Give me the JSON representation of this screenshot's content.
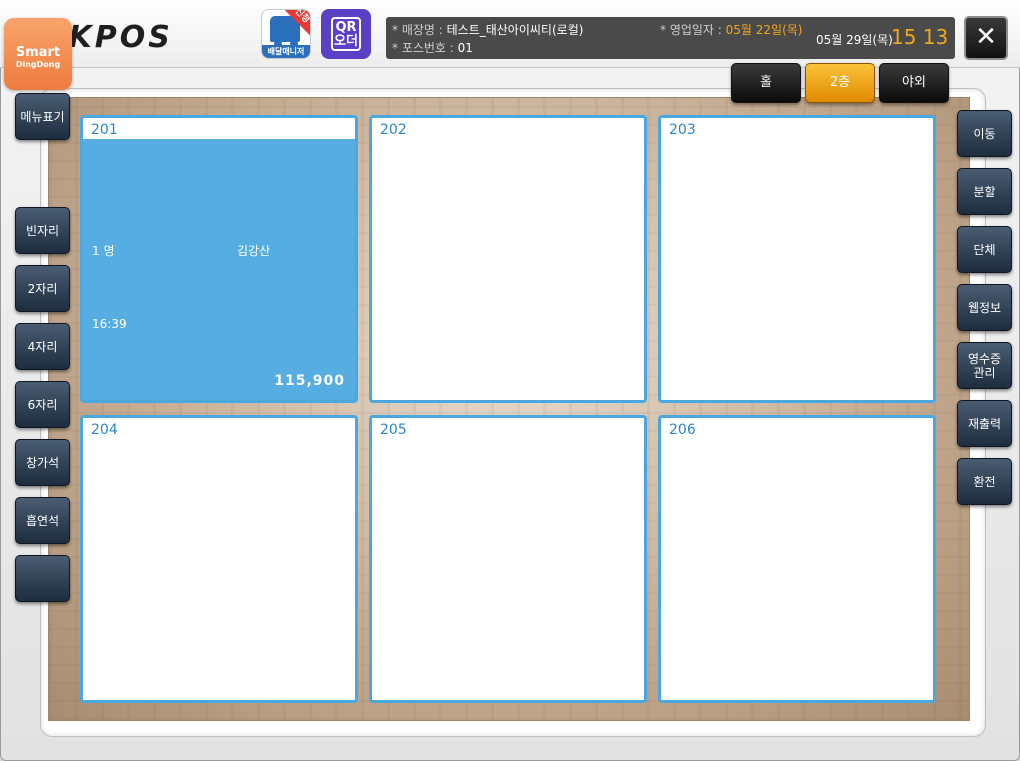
{
  "header": {
    "logo": "OKPOS",
    "smart_badge": {
      "line1": "Smart",
      "line2": "DingDong"
    },
    "delivery_button": {
      "badge": "신청",
      "label": "배달매니저"
    },
    "qr_button": {
      "line1": "QR",
      "line2": "오더"
    },
    "store": {
      "label": "* 매장명 : ",
      "value": "테스트_태산아이씨티(로컬)"
    },
    "pos": {
      "label": "* 포스번호 : ",
      "value": "01"
    },
    "business_date": {
      "label": "* 영업일자 : ",
      "value": "05월 22일(목)"
    },
    "current_date": "05월 29일(목)",
    "current_time": "15 13",
    "close_symbol": "✕"
  },
  "floor_tabs": [
    {
      "label": "홀",
      "active": false
    },
    {
      "label": "2층",
      "active": true
    },
    {
      "label": "야외",
      "active": false
    }
  ],
  "left_buttons": [
    {
      "label": "메뉴표기"
    },
    {
      "label": "빈자리"
    },
    {
      "label": "2자리"
    },
    {
      "label": "4자리"
    },
    {
      "label": "6자리"
    },
    {
      "label": "창가석"
    },
    {
      "label": "흡연석"
    },
    {
      "label": ""
    }
  ],
  "right_buttons": [
    {
      "label": "이동"
    },
    {
      "label": "분할"
    },
    {
      "label": "단체"
    },
    {
      "label": "웹정보"
    },
    {
      "label": "영수증\n관리"
    },
    {
      "label": "재출력"
    },
    {
      "label": "환전"
    }
  ],
  "tables": [
    {
      "number": "201",
      "occupied": true,
      "guests": "1 명",
      "customer": "김강산",
      "since": "16:39",
      "amount": "115,900"
    },
    {
      "number": "202",
      "occupied": false
    },
    {
      "number": "203",
      "occupied": false
    },
    {
      "number": "204",
      "occupied": false
    },
    {
      "number": "205",
      "occupied": false
    },
    {
      "number": "206",
      "occupied": false
    }
  ],
  "colors": {
    "occupied_table": "#56ade2",
    "table_border": "#4aa7e0",
    "accent_orange": "#f2a71b",
    "active_tab": "#f0a31a"
  }
}
